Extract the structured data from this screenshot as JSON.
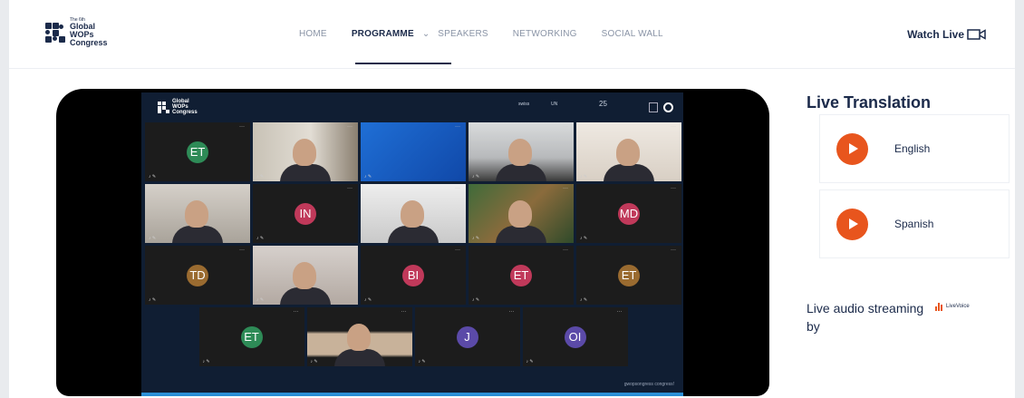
{
  "header": {
    "logo": {
      "line1": "The 6th",
      "line2": "Global",
      "line3": "WOPs",
      "line4": "Congress"
    },
    "nav": [
      {
        "label": "HOME"
      },
      {
        "label": "PROGRAMME",
        "active": true
      },
      {
        "label": "SPEAKERS"
      },
      {
        "label": "NETWORKING"
      },
      {
        "label": "SOCIAL WALL"
      }
    ],
    "nav_chevron": "⌄",
    "watch_live": "Watch Live"
  },
  "player": {
    "stage_logo": {
      "line1": "Global",
      "line2": "WOPs",
      "line3": "Congress"
    },
    "sponsors": [
      "swiss",
      "UN",
      "25"
    ],
    "footer_text": "gwopsongress congress!",
    "tile_dots": "···",
    "tile_mic": "♪ ✎",
    "participants": [
      {
        "initials": "ET",
        "color": "#2e8b57"
      },
      {
        "initials": "",
        "camera": "woman-red-shirt"
      },
      {
        "initials": "",
        "camera": "blue-screen"
      },
      {
        "initials": "",
        "camera": "man-office"
      },
      {
        "initials": "",
        "camera": "woman-white-room"
      },
      {
        "initials": "",
        "camera": "man-glasses"
      },
      {
        "initials": "IN",
        "color": "#c0395a"
      },
      {
        "initials": "",
        "camera": "woman-dark-hair"
      },
      {
        "initials": "",
        "camera": "man-outdoors"
      },
      {
        "initials": "MD",
        "color": "#c0395a"
      },
      {
        "initials": "TD",
        "color": "#9a6b30"
      },
      {
        "initials": "",
        "camera": "woman-waving"
      },
      {
        "initials": "BI",
        "color": "#c0395a"
      },
      {
        "initials": "ET",
        "color": "#c0395a"
      },
      {
        "initials": "ET",
        "color": "#9a6b30"
      },
      {
        "initials": "ET",
        "color": "#2e8b57"
      },
      {
        "initials": "",
        "camera": "man-vertical"
      },
      {
        "initials": "J",
        "color": "#5b4aa8"
      },
      {
        "initials": "OI",
        "color": "#5b4aa8"
      }
    ]
  },
  "right_panel": {
    "title": "Live Translation",
    "languages": [
      {
        "label": "English"
      },
      {
        "label": "Spanish"
      }
    ],
    "streaming_text": "Live audio streaming by",
    "provider": "LiveVoice"
  },
  "colors": {
    "accent": "#e8551d",
    "navy": "#1b2a4a",
    "stage": "#101e33"
  }
}
